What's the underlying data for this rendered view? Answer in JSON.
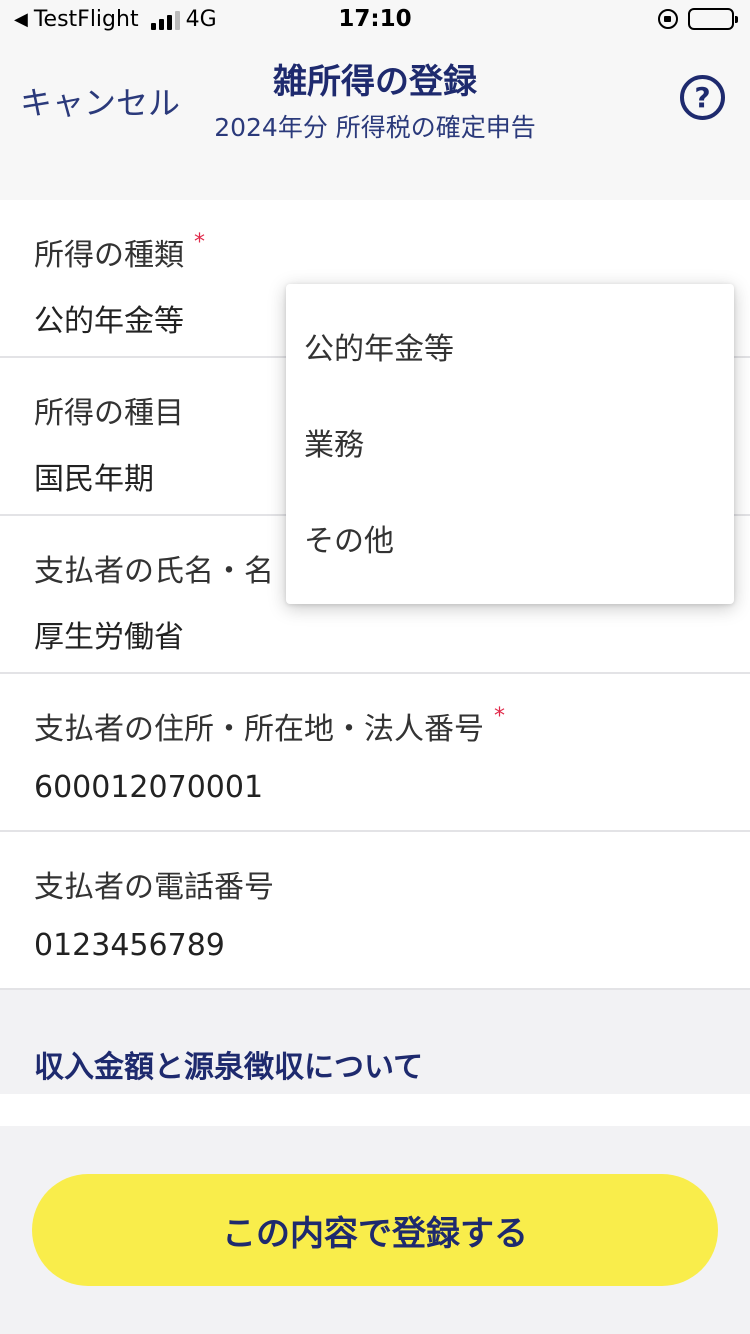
{
  "statusbar": {
    "carrier": "TestFlight",
    "network": "4G",
    "time": "17:10"
  },
  "nav": {
    "cancel_label": "キャンセル",
    "title": "雑所得の登録",
    "subtitle": "2024年分 所得税の確定申告",
    "help_label": "?"
  },
  "form": {
    "fields": [
      {
        "label": "所得の種類",
        "required": "*",
        "value": "公的年金等"
      },
      {
        "label": "所得の種目",
        "value": "国民年期"
      },
      {
        "label": "支払者の氏名・名",
        "value": "厚生労働省"
      },
      {
        "label": "支払者の住所・所在地・法人番号",
        "required": "*",
        "value": "600012070001"
      },
      {
        "label": "支払者の電話番号",
        "value": "0123456789"
      }
    ]
  },
  "section": {
    "title": "収入金額と源泉徴収について"
  },
  "dropdown": {
    "options": [
      "公的年金等",
      "業務",
      "その他"
    ]
  },
  "footer": {
    "submit_label": "この内容で登録する"
  },
  "colors": {
    "accent": "#1e2a6e",
    "required": "#e0294a",
    "button": "#f9ed4b"
  }
}
